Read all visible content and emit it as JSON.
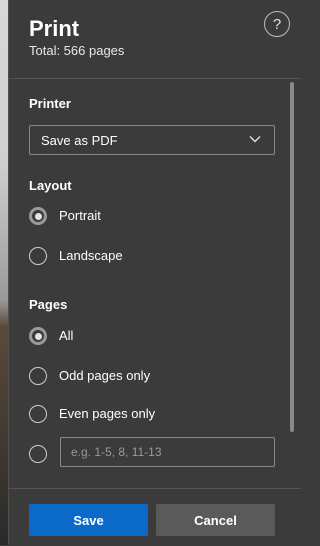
{
  "dialog": {
    "title": "Print",
    "subtitle": "Total: 566 pages",
    "help_glyph": "?"
  },
  "printer": {
    "label": "Printer",
    "selected": "Save as PDF"
  },
  "layout": {
    "label": "Layout",
    "options": [
      {
        "label": "Portrait",
        "checked": true
      },
      {
        "label": "Landscape",
        "checked": false
      }
    ]
  },
  "pages": {
    "label": "Pages",
    "options": [
      {
        "label": "All",
        "checked": true
      },
      {
        "label": "Odd pages only",
        "checked": false
      },
      {
        "label": "Even pages only",
        "checked": false
      }
    ],
    "custom_placeholder": "e.g. 1-5, 8, 11-13"
  },
  "footer": {
    "save_label": "Save",
    "cancel_label": "Cancel"
  },
  "colors": {
    "panel_bg": "#3b3b3b",
    "accent": "#0b6ac7",
    "secondary_button": "#5a5a5a"
  },
  "icons": {
    "help": "help-icon",
    "dropdown": "chevron-down-icon"
  }
}
